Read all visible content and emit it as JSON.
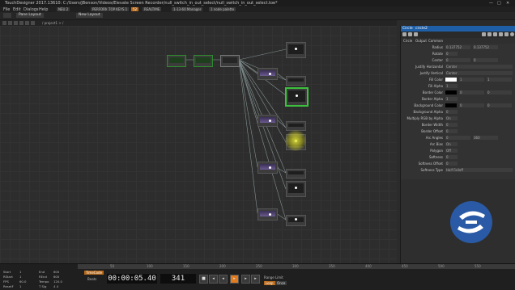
{
  "window": {
    "title": "TouchDesigner 2017.13610: C:/Users/jBenson/Videos/Elevate Screen Recorder/null_switch_in_out_select/null_switch_in_out_select.toe*",
    "min": "—",
    "max": "□",
    "close": "✕"
  },
  "menu": {
    "items": [
      "File",
      "Edit",
      "Dialogs",
      "Help"
    ],
    "tags": [
      "NEU 2",
      "PERFORM 1",
      "TOP KEYS 1",
      "REALTIME",
      "1-13-60 Manager",
      "1 node palette"
    ],
    "active_tag": "52"
  },
  "toolbar": {
    "pane_layout": "Pane Layout",
    "new_layout": "New Layout"
  },
  "path": {
    "text": "/ project1 > /"
  },
  "panel": {
    "op_type": "Circle",
    "op_name": "circle2",
    "tabs": [
      "Circle",
      "Output",
      "Common"
    ],
    "params": [
      {
        "label": "Radius",
        "v1": "0.137752",
        "v2": "0.137752"
      },
      {
        "label": "Rotate",
        "v1": "0",
        "v2": ""
      },
      {
        "label": "Center",
        "v1": "0",
        "v2": "0"
      },
      {
        "label": "Justify Horizontal",
        "v1": "Center",
        "v2": ""
      },
      {
        "label": "Justify Vertical",
        "v1": "Center",
        "v2": ""
      },
      {
        "label": "Fill Color",
        "v1": "1",
        "v2": "1"
      },
      {
        "label": "Fill Alpha",
        "v1": "1",
        "v2": ""
      },
      {
        "label": "Border Color",
        "v1": "0",
        "v2": "0"
      },
      {
        "label": "Border Alpha",
        "v1": "1",
        "v2": ""
      },
      {
        "label": "Background Color",
        "v1": "0",
        "v2": "0"
      },
      {
        "label": "Background Alpha",
        "v1": "0",
        "v2": ""
      },
      {
        "label": "Multiply RGB by Alpha",
        "v1": "On",
        "v2": ""
      },
      {
        "label": "Border Width",
        "v1": "0",
        "v2": ""
      },
      {
        "label": "Border Offset",
        "v1": "0",
        "v2": ""
      },
      {
        "label": "Arc Angles",
        "v1": "0",
        "v2": "360"
      },
      {
        "label": "Arc Bias",
        "v1": "On",
        "v2": ""
      },
      {
        "label": "Polygon",
        "v1": "Off",
        "v2": ""
      },
      {
        "label": "Softness",
        "v1": "0",
        "v2": ""
      },
      {
        "label": "Softness Offset",
        "v1": "0",
        "v2": ""
      },
      {
        "label": "Softness Type",
        "v1": "Half Falloff",
        "v2": ""
      }
    ]
  },
  "timeline": {
    "timecode": "00:00:05.40",
    "frame": "341",
    "info": {
      "start": "Start",
      "start_v": "1",
      "rstart": "RStart",
      "rstart_v": "1",
      "fps": "FPS",
      "fps_v": "60.0",
      "resetf": "ResetF",
      "resetf_v": "1",
      "end": "End",
      "end_v": "600",
      "rend": "REnd",
      "rend_v": "600",
      "tempo": "Tempo",
      "tempo_v": "120.0",
      "tsig": "T Sig",
      "tsig_v": "4 4"
    },
    "ruler_ticks": [
      "50",
      "100",
      "150",
      "200",
      "250",
      "300",
      "350",
      "400",
      "450",
      "500",
      "550"
    ],
    "timecode_label": "TimeCode",
    "beats_label": "Beats",
    "range_limit": "Range Limit",
    "loop": "Loop",
    "once": "Once"
  },
  "colors": {
    "accent_blue": "#1f5fa8",
    "selection_green": "#3cc13c",
    "play_orange": "#e07b1e",
    "logo_blue": "#2a5aa6"
  }
}
